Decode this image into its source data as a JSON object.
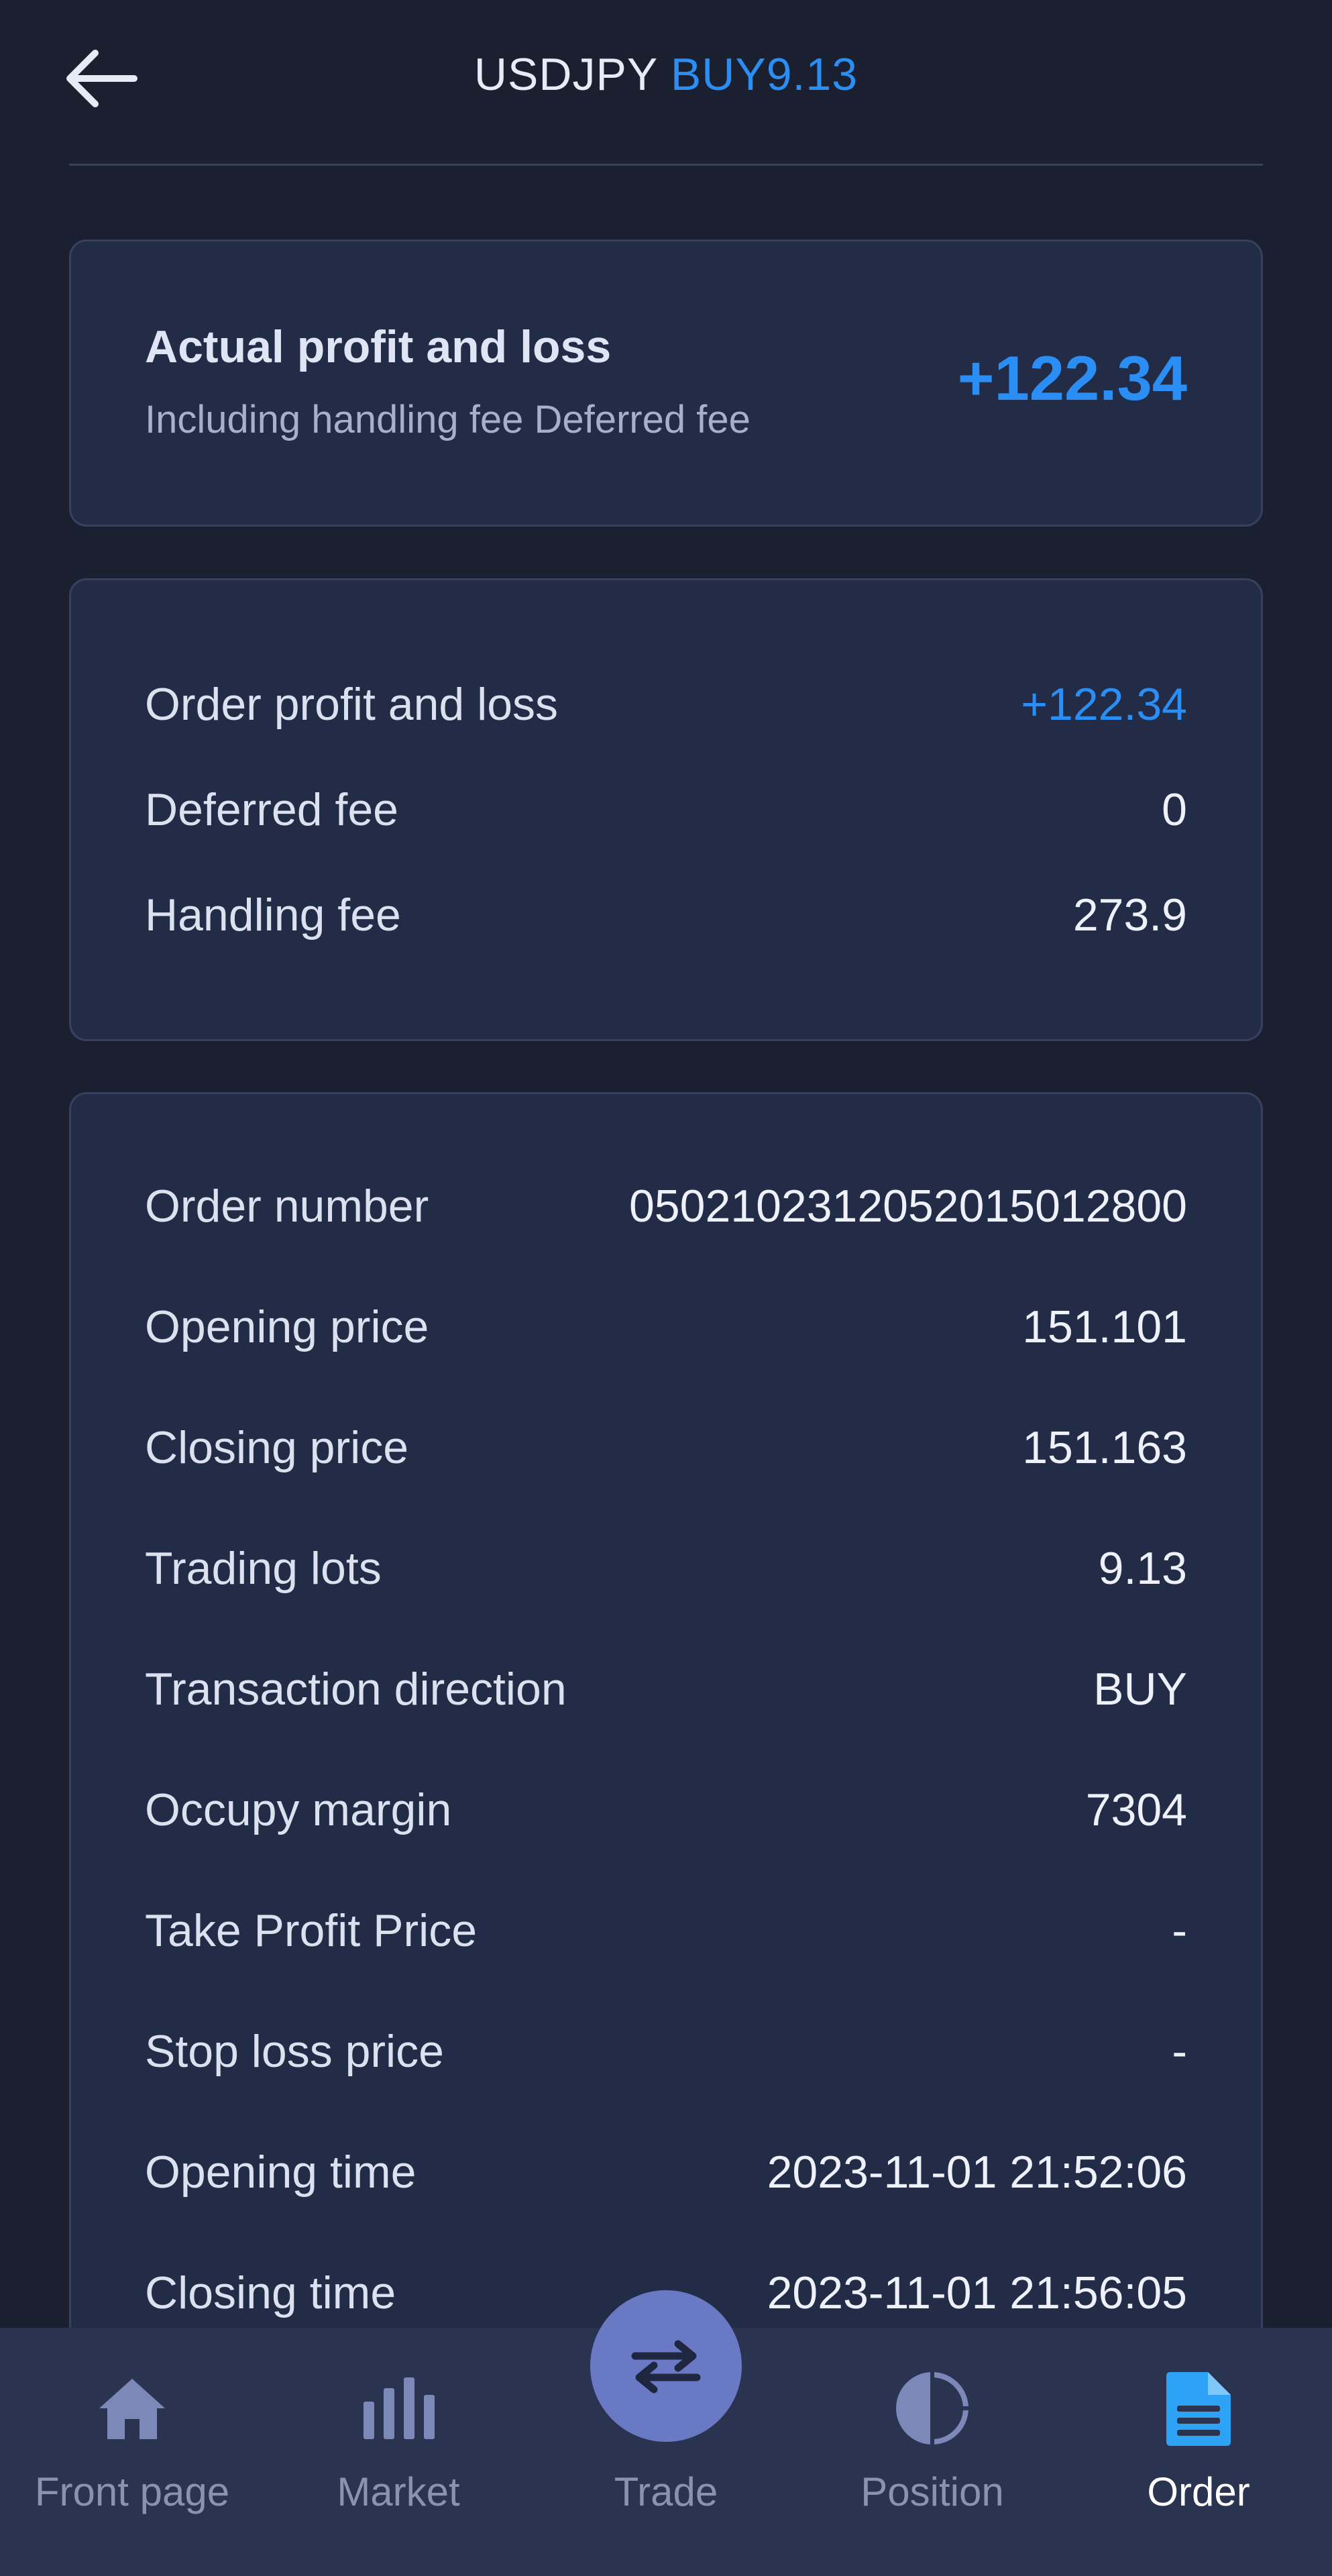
{
  "header": {
    "symbol": "USDJPY",
    "side_lots": "BUY9.13"
  },
  "actual_pnl": {
    "title": "Actual profit and loss",
    "subtitle": "Including handling fee Deferred fee",
    "value": "+122.34"
  },
  "fees": [
    {
      "label": "Order profit and loss",
      "value": "+122.34"
    },
    {
      "label": "Deferred fee",
      "value": "0"
    },
    {
      "label": "Handling fee",
      "value": "273.9"
    }
  ],
  "details": [
    {
      "label": "Order number",
      "value": "050210231205201501280​0"
    },
    {
      "label": "Opening price",
      "value": "151.101"
    },
    {
      "label": "Closing price",
      "value": "151.163"
    },
    {
      "label": "Trading lots",
      "value": "9.13"
    },
    {
      "label": "Transaction direction",
      "value": "BUY"
    },
    {
      "label": "Occupy margin",
      "value": "7304"
    },
    {
      "label": "Take Profit Price",
      "value": "-"
    },
    {
      "label": "Stop loss price",
      "value": "-"
    },
    {
      "label": "Opening time",
      "value": "2023-11-01 21:52:06"
    },
    {
      "label": "Closing time",
      "value": "2023-11-01 21:56:05"
    }
  ],
  "nav": {
    "front_page": "Front page",
    "market": "Market",
    "trade": "Trade",
    "position": "Position",
    "order": "Order"
  },
  "colors": {
    "background": "#1b2030",
    "card": "#232c46",
    "accent_blue": "#2a8ef5",
    "nav_bg": "#2a3450",
    "trade_button": "#6a79c3"
  }
}
